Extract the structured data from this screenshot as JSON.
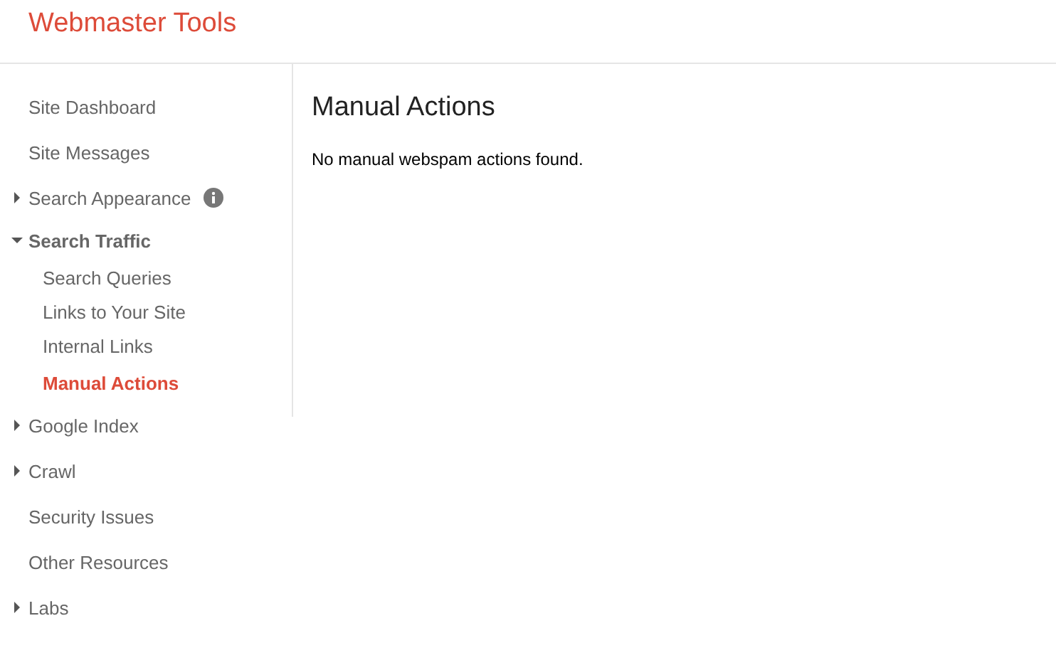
{
  "header": {
    "title": "Webmaster Tools"
  },
  "sidebar": {
    "items": [
      {
        "label": "Site Dashboard",
        "kind": "link",
        "selected": false
      },
      {
        "label": "Site Messages",
        "kind": "link",
        "selected": false
      },
      {
        "label": "Search Appearance",
        "kind": "section",
        "expanded": false,
        "selected": false,
        "info": true
      },
      {
        "label": "Search Traffic",
        "kind": "section",
        "expanded": true,
        "selected": false,
        "children": [
          {
            "label": "Search Queries",
            "selected": false
          },
          {
            "label": "Links to Your Site",
            "selected": false
          },
          {
            "label": "Internal Links",
            "selected": false
          },
          {
            "label": "Manual Actions",
            "selected": true
          }
        ]
      },
      {
        "label": "Google Index",
        "kind": "section",
        "expanded": false,
        "selected": false
      },
      {
        "label": "Crawl",
        "kind": "section",
        "expanded": false,
        "selected": false
      },
      {
        "label": "Security Issues",
        "kind": "link",
        "selected": false
      },
      {
        "label": "Other Resources",
        "kind": "link",
        "selected": false
      },
      {
        "label": "Labs",
        "kind": "section",
        "expanded": false,
        "selected": false
      }
    ]
  },
  "main": {
    "title": "Manual Actions",
    "message": "No manual webspam actions found."
  }
}
